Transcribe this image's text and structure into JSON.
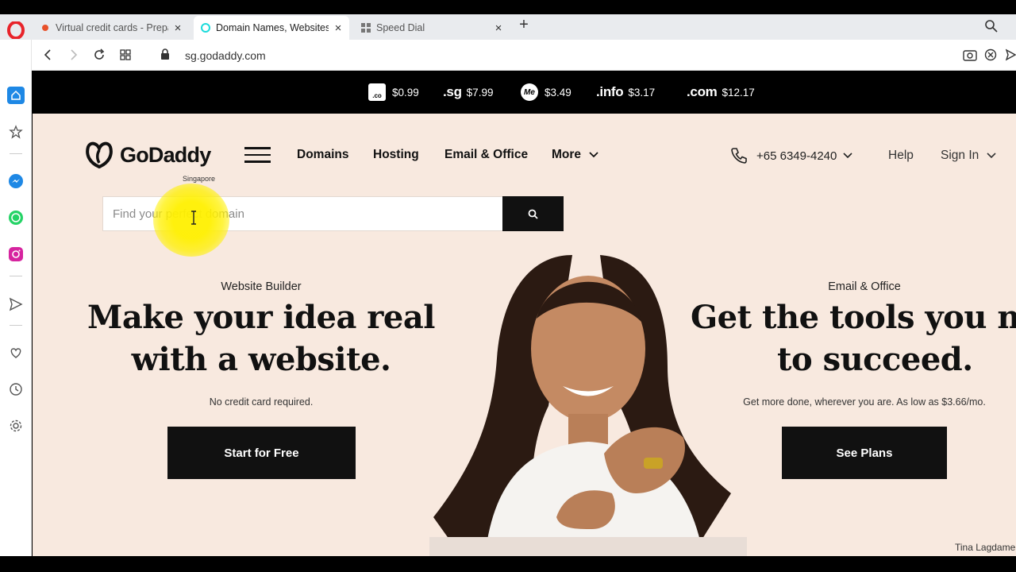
{
  "browser": {
    "tabs": [
      {
        "title": "Virtual credit cards - Prepa",
        "favicon_color": "#e8512a"
      },
      {
        "title": "Domain Names, Websites, H",
        "favicon_color": "#1bdbdb"
      },
      {
        "title": "Speed Dial",
        "favicon_color": "#777777"
      }
    ],
    "new_tab_label": "+",
    "url": "sg.godaddy.com"
  },
  "promo_bar": [
    {
      "tld": ".co",
      "price": "$0.99",
      "icon": "co-badge"
    },
    {
      "tld": ".sg",
      "price": "$7.99",
      "icon": ""
    },
    {
      "tld": "Me",
      "price": "$3.49",
      "icon": "me-badge"
    },
    {
      "tld": ".info",
      "price": "$3.17",
      "icon": ""
    },
    {
      "tld": ".com",
      "price": "$12.17",
      "icon": ""
    }
  ],
  "header": {
    "logo_text": "GoDaddy",
    "logo_sub": "Singapore",
    "nav": [
      "Domains",
      "Hosting",
      "Email & Office",
      "More"
    ],
    "phone": "+65 6349-4240",
    "help": "Help",
    "sign_in": "Sign In"
  },
  "search": {
    "placeholder": "Find your perfect domain"
  },
  "hero_left": {
    "kicker": "Website Builder",
    "headline_line1": "Make your idea real",
    "headline_line2": "with a website.",
    "subtext": "No credit card required.",
    "cta": "Start for Free"
  },
  "hero_right": {
    "kicker": "Email & Office",
    "headline_line1": "Get the tools you nee",
    "headline_line2": "to succeed.",
    "subtext": "Get more done, wherever you are. As low as $3.66/mo.",
    "cta": "See Plans"
  },
  "photo_credit": "Tina Lagdame",
  "colors": {
    "page_bg": "#f8e9df",
    "brand_black": "#111111",
    "promo_bg": "#000000"
  }
}
